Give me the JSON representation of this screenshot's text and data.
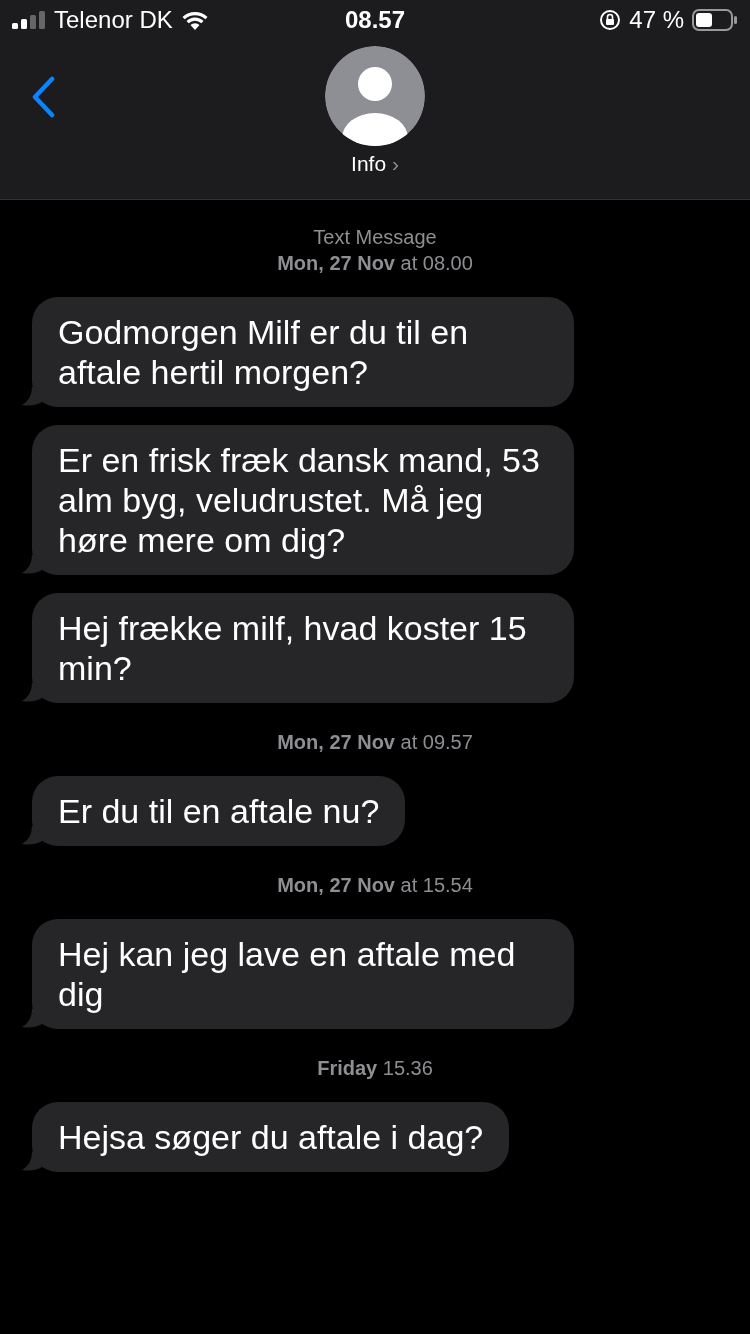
{
  "status_bar": {
    "carrier": "Telenor DK",
    "time": "08.57",
    "battery": "47 %"
  },
  "header": {
    "info_label": "Info",
    "chevron": "›"
  },
  "groups": [
    {
      "service": "Text Message",
      "day": "Mon, 27 Nov",
      "time": "at 08.00",
      "messages": [
        "Godmorgen Milf er du til en aftale hertil morgen?",
        "Er en frisk fræk dansk mand, 53 alm byg, veludrustet. Må jeg høre mere om dig?",
        "Hej frække milf, hvad koster 15 min?"
      ]
    },
    {
      "day": "Mon, 27 Nov",
      "time": "at 09.57",
      "messages": [
        "Er du til en aftale nu?"
      ]
    },
    {
      "day": "Mon, 27 Nov",
      "time": "at 15.54",
      "messages": [
        "Hej kan jeg lave en aftale med dig"
      ]
    },
    {
      "day": "Friday",
      "time": "15.36",
      "messages": [
        "Hejsa søger du aftale i dag?"
      ]
    }
  ]
}
